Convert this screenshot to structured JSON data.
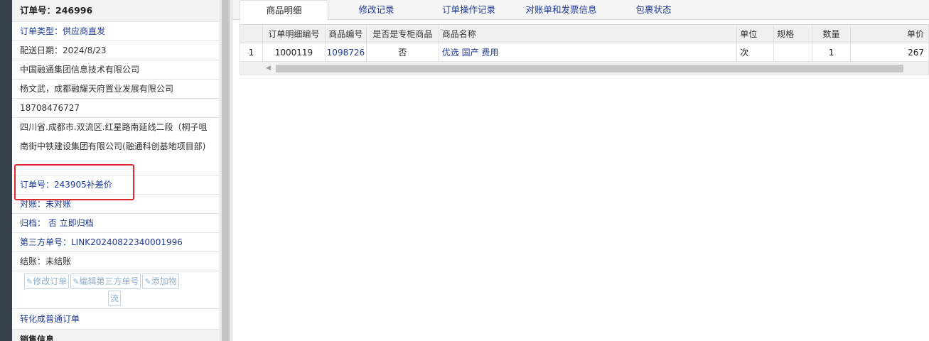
{
  "panel": {
    "order_no": "订单号：246996",
    "order_type": "订单类型：供应商直发",
    "delivery_date": "配送日期：2024/8/23",
    "company": "中国融通集团信息技术有限公司",
    "contact": "杨文武，成都融耀天府置业发展有限公司",
    "phone": "18708476727",
    "address": "四川省.成都市.双流区.红星路南延线二段（桐子咀南街中铁建设集团有限公司(融通科创基地项目部)",
    "related_order": "订单号：243905补差价",
    "reconcile": "对账：未对账",
    "archive": "归档：  否 立即归档",
    "third_party_no": "第三方单号：LINK20240822340001996",
    "settle": "结账：未结账",
    "buttons": {
      "modify_order": "修改订单",
      "edit_third": "编辑第三方单号",
      "add_logistics_1": "添加物",
      "add_logistics_2": "流"
    },
    "convert": "转化成普通订单",
    "sales_info": "销售信息"
  },
  "tabs": [
    {
      "label": "商品明细"
    },
    {
      "label": "修改记录"
    },
    {
      "label": "订单操作记录"
    },
    {
      "label": "对账单和发票信息"
    },
    {
      "label": "包裹状态"
    }
  ],
  "table": {
    "headers": [
      "",
      "订单明细编号",
      "商品编号",
      "是否是专柜商品",
      "商品名称",
      "单位",
      "规格",
      "数量",
      "单价"
    ],
    "rows": [
      {
        "idx": "1",
        "detail_no": "1000119",
        "product_no": "1098726",
        "is_counter": "否",
        "name": "优选 国产 费用",
        "unit": "次",
        "spec": "",
        "qty": "1",
        "price": "267"
      }
    ]
  },
  "colors": {
    "link": "#1f3a93",
    "highlight": "#e0282c",
    "sidebar": "#34404c"
  }
}
